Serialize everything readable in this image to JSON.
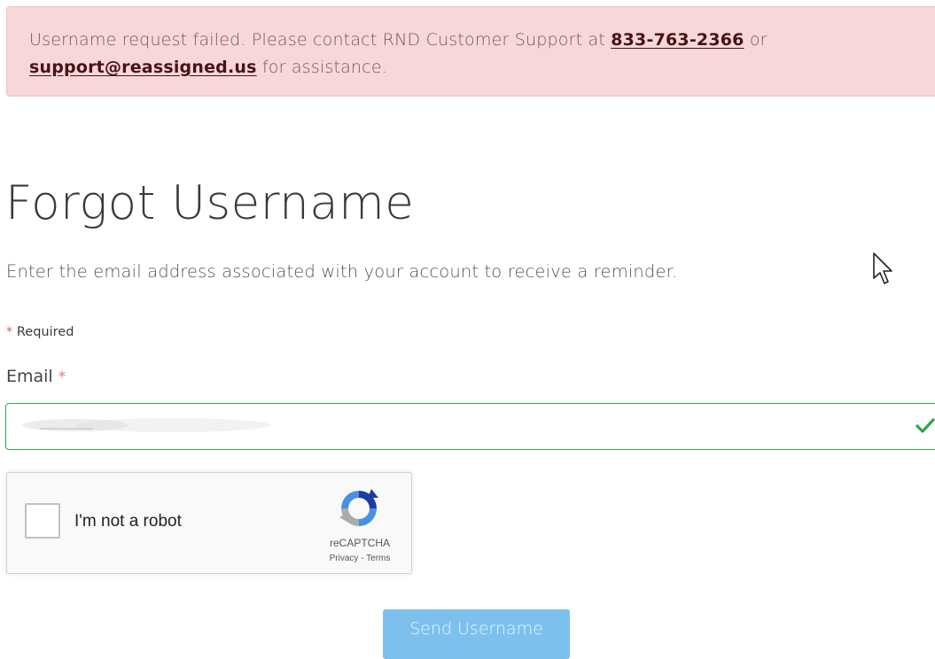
{
  "alert": {
    "text_before": "Username request failed. Please contact RND Customer Support at ",
    "phone": "833-763-2366",
    "text_middle": " or ",
    "email": "support@reassigned.us",
    "text_after": " for assistance."
  },
  "page": {
    "title": "Forgot Username",
    "instructions": "Enter the email address associated with your account to receive a reminder."
  },
  "form": {
    "required_star": "*",
    "required_note": "Required",
    "email_label": "Email",
    "email_value": "",
    "email_valid": true,
    "email_border_color": "#2ea64a"
  },
  "recaptcha": {
    "label": "I'm not a robot",
    "brand": "reCAPTCHA",
    "links": "Privacy - Terms",
    "checked": false
  },
  "actions": {
    "send_label": "Send Username",
    "send_color": "#7cc1ee"
  },
  "icons": {
    "checkmark": "check-icon",
    "recaptcha_logo": "recaptcha-logo-icon",
    "cursor": "mouse-pointer-icon"
  }
}
